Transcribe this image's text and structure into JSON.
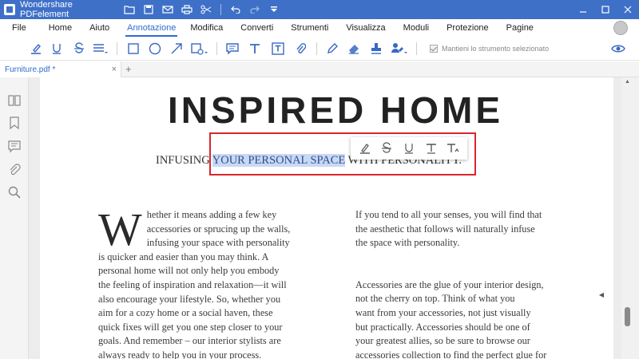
{
  "app": {
    "title": "Wondershare PDFelement"
  },
  "menu": {
    "items": [
      "File",
      "Home",
      "Aiuto",
      "Annotazione",
      "Modifica",
      "Converti",
      "Strumenti",
      "Visualizza",
      "Moduli",
      "Protezione",
      "Pagine"
    ],
    "active_index": 3
  },
  "toolbar": {
    "keep_tool_label": "Mantieni lo strumento selezionato",
    "icons": [
      "highlight-icon",
      "underline-icon",
      "strikethrough-icon",
      "text-align-icon",
      "rectangle-icon",
      "circle-icon",
      "arrow-icon",
      "shape-dropdown-icon",
      "comment-icon",
      "text-icon",
      "textbox-icon",
      "attachment-icon",
      "pencil-icon",
      "eraser-icon",
      "stamp-icon",
      "signature-icon",
      "eye-icon"
    ]
  },
  "tabs": {
    "document": "Furniture.pdf *",
    "close": "×",
    "add": "+"
  },
  "document": {
    "title": "INSPIRED HOME",
    "subtitle_before": "INFUSING ",
    "subtitle_selected": "YOUR PERSONAL SPACE",
    "subtitle_after": " WITH PERSONALITY.",
    "drop_cap": "W",
    "left_lines": [
      "hether it means adding a few key",
      "accessories or sprucing up the walls,",
      "infusing your space with personality",
      "is quicker and easier than you may think. A",
      "personal home will not only help you embody",
      "the feeling of inspiration and relaxation—it will",
      "also encourage your lifestyle. So, whether you",
      "aim for a cozy home or a social haven, these",
      "quick fixes will get you one step closer to your",
      "goals. And remember – our interior stylists are",
      "always ready to help you in your process."
    ],
    "right_para1": [
      "If you tend to all your senses, you will find that",
      "the aesthetic that follows will naturally infuse",
      "the space with personality."
    ],
    "right_para2": [
      "Accessories are the glue of your interior design,",
      "not the cherry on top. Think of what you",
      "want from your accessories, not just visually",
      "but practically. Accessories should be one of",
      "your greatest allies, so be sure to browse our",
      "accessories collection to find the perfect glue for"
    ]
  },
  "colors": {
    "titlebar": "#3e70c8",
    "accent": "#2f6bd0",
    "selection": "#c9d8f4",
    "highlight_box": "#d9262b"
  }
}
